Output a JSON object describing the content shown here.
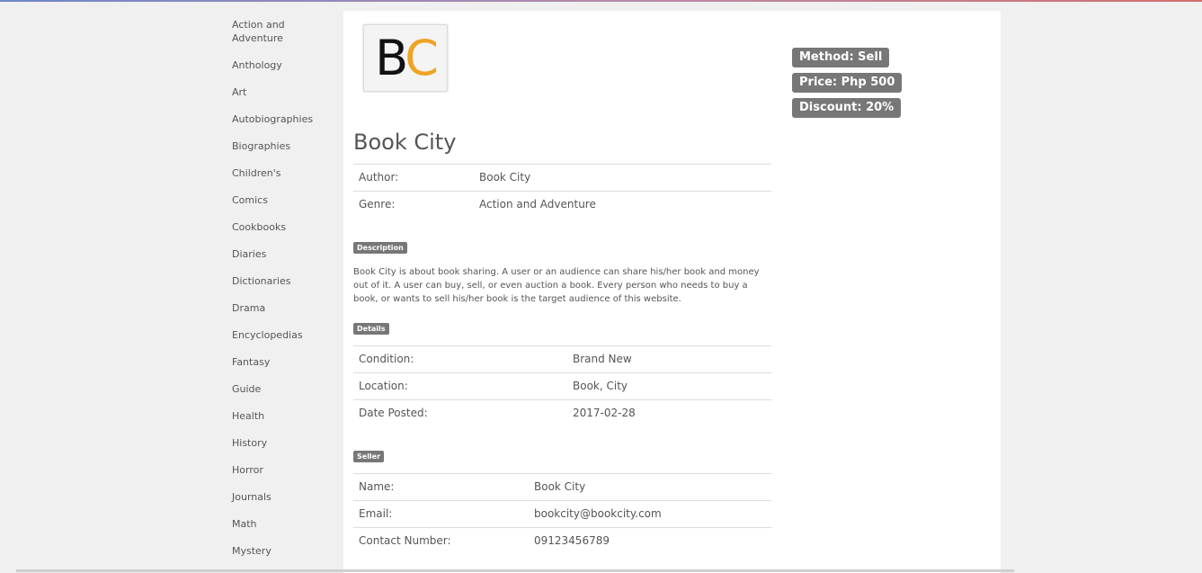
{
  "categories": [
    "Action and Adventure",
    "Anthology",
    "Art",
    "Autobiographies",
    "Biographies",
    "Children's",
    "Comics",
    "Cookbooks",
    "Diaries",
    "Dictionaries",
    "Drama",
    "Encyclopedias",
    "Fantasy",
    "Guide",
    "Health",
    "History",
    "Horror",
    "Journals",
    "Math",
    "Mystery"
  ],
  "logo": {
    "first": "B",
    "second": "C"
  },
  "book": {
    "title": "Book City",
    "author_label": "Author:",
    "author": "Book City",
    "genre_label": "Genre:",
    "genre": "Action and Adventure"
  },
  "description": {
    "label": "Description",
    "text": "Book City is about book sharing. A user or an audience can share his/her book and money out of it. A user can buy, sell, or even auction a book. Every person who needs to buy a book, or wants to sell his/her book is the target audience of this website."
  },
  "details": {
    "label": "Details",
    "condition_label": "Condition:",
    "condition": "Brand New",
    "location_label": "Location:",
    "location": "Book, City",
    "date_label": "Date Posted:",
    "date": "2017-02-28"
  },
  "seller": {
    "label": "Seller",
    "name_label": "Name:",
    "name": "Book City",
    "email_label": "Email:",
    "email": "bookcity@bookcity.com",
    "contact_label": "Contact Number:",
    "contact": "09123456789"
  },
  "badges": {
    "method": "Method: Sell",
    "price": "Price: Php 500",
    "discount": "Discount: 20%"
  },
  "colors": {
    "badge_bg": "#777777",
    "logo_c": "#f0a323",
    "panel_bg": "#ffffff",
    "page_bg": "#f0f0f0"
  }
}
